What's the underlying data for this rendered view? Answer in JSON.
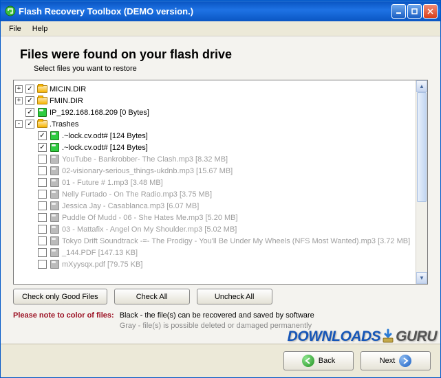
{
  "window": {
    "title": "Flash Recovery Toolbox (DEMO version.)"
  },
  "menu": {
    "file": "File",
    "help": "Help"
  },
  "heading": "Files were found on your flash drive",
  "subheading": "Select files you want to restore",
  "tree": [
    {
      "indent": 0,
      "expand": "+",
      "checked": true,
      "icon": "folder",
      "status": "good",
      "label": "MICIN.DIR"
    },
    {
      "indent": 0,
      "expand": "+",
      "checked": true,
      "icon": "folder",
      "status": "good",
      "label": "FMIN.DIR"
    },
    {
      "indent": 0,
      "expand": "",
      "checked": true,
      "icon": "disk-green",
      "status": "good",
      "label": "IP_192.168.168.209   [0 Bytes]"
    },
    {
      "indent": 0,
      "expand": "-",
      "checked": true,
      "icon": "folder",
      "status": "good",
      "label": ".Trashes"
    },
    {
      "indent": 1,
      "expand": "",
      "checked": true,
      "icon": "disk-green",
      "status": "good",
      "label": ".~lock.cv.odt#   [124 Bytes]"
    },
    {
      "indent": 1,
      "expand": "",
      "checked": true,
      "icon": "disk-green",
      "status": "good",
      "label": ".~lock.cv.odt#   [124 Bytes]"
    },
    {
      "indent": 1,
      "expand": "",
      "checked": false,
      "icon": "disk-gray",
      "status": "bad",
      "label": "YouTube - Bankrobber- The Clash.mp3   [8.32 MB]"
    },
    {
      "indent": 1,
      "expand": "",
      "checked": false,
      "icon": "disk-gray",
      "status": "bad",
      "label": "02-visionary-serious_things-ukdnb.mp3   [15.67 MB]"
    },
    {
      "indent": 1,
      "expand": "",
      "checked": false,
      "icon": "disk-gray",
      "status": "bad",
      "label": "01 - Future # 1.mp3   [3.48 MB]"
    },
    {
      "indent": 1,
      "expand": "",
      "checked": false,
      "icon": "disk-gray",
      "status": "bad",
      "label": "Nelly Furtado - On The Radio.mp3   [3.75 MB]"
    },
    {
      "indent": 1,
      "expand": "",
      "checked": false,
      "icon": "disk-gray",
      "status": "bad",
      "label": "Jessica Jay - Casablanca.mp3   [6.07 MB]"
    },
    {
      "indent": 1,
      "expand": "",
      "checked": false,
      "icon": "disk-gray",
      "status": "bad",
      "label": "Puddle Of Mudd - 06 - She Hates Me.mp3   [5.20 MB]"
    },
    {
      "indent": 1,
      "expand": "",
      "checked": false,
      "icon": "disk-gray",
      "status": "bad",
      "label": "03 - Mattafix - Angel On My Shoulder.mp3   [5.02 MB]"
    },
    {
      "indent": 1,
      "expand": "",
      "checked": false,
      "icon": "disk-gray",
      "status": "bad",
      "label": "Tokyo Drift Soundtrack  -=- The Prodigy - You'll Be Under My Wheels (NFS Most Wanted).mp3   [3.72 MB]"
    },
    {
      "indent": 1,
      "expand": "",
      "checked": false,
      "icon": "disk-gray",
      "status": "bad",
      "label": "_144.PDF   [147.13 KB]"
    },
    {
      "indent": 1,
      "expand": "",
      "checked": false,
      "icon": "disk-gray",
      "status": "bad",
      "label": "mXyysqx.pdf   [79.75 KB]"
    }
  ],
  "buttons": {
    "checkGood": "Check only Good Files",
    "checkAll": "Check All",
    "uncheckAll": "Uncheck All"
  },
  "note": {
    "prefix": "Please note to color of files:",
    "black": "Black - the file(s) can be recovered and saved by software",
    "gray": "Gray - file(s) is possible deleted or damaged permanently"
  },
  "footer": {
    "back": "Back",
    "next": "Next"
  },
  "watermark": {
    "p1": "DOWNLOADS",
    "p2": "GURU"
  }
}
